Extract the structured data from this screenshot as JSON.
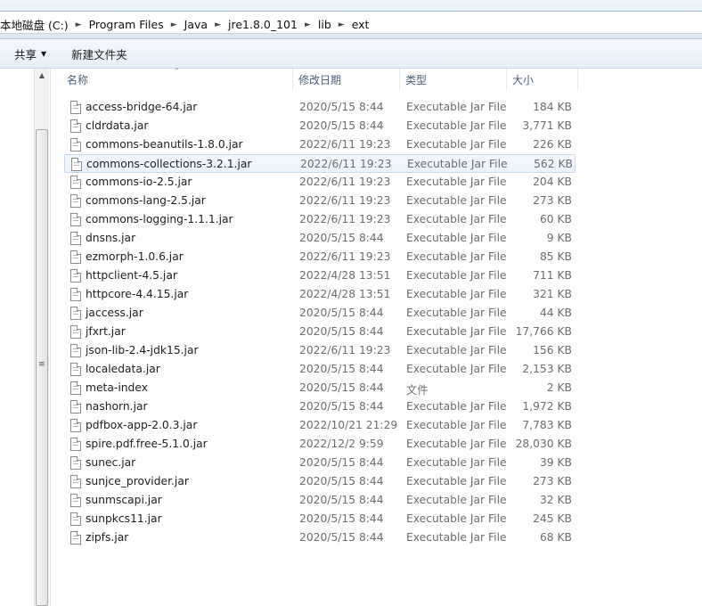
{
  "breadcrumbs": [
    "本地磁盘 (C:)",
    "Program Files",
    "Java",
    "jre1.8.0_101",
    "lib",
    "ext"
  ],
  "toolbar": {
    "share_label": "共享",
    "new_folder_label": "新建文件夹"
  },
  "columns": {
    "name": "名称",
    "date": "修改日期",
    "type": "类型",
    "size": "大小"
  },
  "sort": {
    "column": "name",
    "direction": "ascending"
  },
  "selected_index": 3,
  "files": [
    {
      "name": "access-bridge-64.jar",
      "date": "2020/5/15 8:44",
      "type": "Executable Jar File",
      "size": "184 KB"
    },
    {
      "name": "cldrdata.jar",
      "date": "2020/5/15 8:44",
      "type": "Executable Jar File",
      "size": "3,771 KB"
    },
    {
      "name": "commons-beanutils-1.8.0.jar",
      "date": "2022/6/11 19:23",
      "type": "Executable Jar File",
      "size": "226 KB"
    },
    {
      "name": "commons-collections-3.2.1.jar",
      "date": "2022/6/11 19:23",
      "type": "Executable Jar File",
      "size": "562 KB"
    },
    {
      "name": "commons-io-2.5.jar",
      "date": "2022/6/11 19:23",
      "type": "Executable Jar File",
      "size": "204 KB"
    },
    {
      "name": "commons-lang-2.5.jar",
      "date": "2022/6/11 19:23",
      "type": "Executable Jar File",
      "size": "273 KB"
    },
    {
      "name": "commons-logging-1.1.1.jar",
      "date": "2022/6/11 19:23",
      "type": "Executable Jar File",
      "size": "60 KB"
    },
    {
      "name": "dnsns.jar",
      "date": "2020/5/15 8:44",
      "type": "Executable Jar File",
      "size": "9 KB"
    },
    {
      "name": "ezmorph-1.0.6.jar",
      "date": "2022/6/11 19:23",
      "type": "Executable Jar File",
      "size": "85 KB"
    },
    {
      "name": "httpclient-4.5.jar",
      "date": "2022/4/28 13:51",
      "type": "Executable Jar File",
      "size": "711 KB"
    },
    {
      "name": "httpcore-4.4.15.jar",
      "date": "2022/4/28 13:51",
      "type": "Executable Jar File",
      "size": "321 KB"
    },
    {
      "name": "jaccess.jar",
      "date": "2020/5/15 8:44",
      "type": "Executable Jar File",
      "size": "44 KB"
    },
    {
      "name": "jfxrt.jar",
      "date": "2020/5/15 8:44",
      "type": "Executable Jar File",
      "size": "17,766 KB"
    },
    {
      "name": "json-lib-2.4-jdk15.jar",
      "date": "2022/6/11 19:23",
      "type": "Executable Jar File",
      "size": "156 KB"
    },
    {
      "name": "localedata.jar",
      "date": "2020/5/15 8:44",
      "type": "Executable Jar File",
      "size": "2,153 KB"
    },
    {
      "name": "meta-index",
      "date": "2020/5/15 8:44",
      "type": "文件",
      "size": "2 KB"
    },
    {
      "name": "nashorn.jar",
      "date": "2020/5/15 8:44",
      "type": "Executable Jar File",
      "size": "1,972 KB"
    },
    {
      "name": "pdfbox-app-2.0.3.jar",
      "date": "2022/10/21 21:29",
      "type": "Executable Jar File",
      "size": "7,783 KB"
    },
    {
      "name": "spire.pdf.free-5.1.0.jar",
      "date": "2022/12/2 9:59",
      "type": "Executable Jar File",
      "size": "28,030 KB"
    },
    {
      "name": "sunec.jar",
      "date": "2020/5/15 8:44",
      "type": "Executable Jar File",
      "size": "39 KB"
    },
    {
      "name": "sunjce_provider.jar",
      "date": "2020/5/15 8:44",
      "type": "Executable Jar File",
      "size": "273 KB"
    },
    {
      "name": "sunmscapi.jar",
      "date": "2020/5/15 8:44",
      "type": "Executable Jar File",
      "size": "32 KB"
    },
    {
      "name": "sunpkcs11.jar",
      "date": "2020/5/15 8:44",
      "type": "Executable Jar File",
      "size": "245 KB"
    },
    {
      "name": "zipfs.jar",
      "date": "2020/5/15 8:44",
      "type": "Executable Jar File",
      "size": "68 KB"
    }
  ],
  "icons": {
    "file": "file-icon",
    "separator": "chevron-right-icon",
    "dropdown": "dropdown-arrow-icon",
    "sort": "sort-arrow-icon",
    "scroll_up": "scroll-up-arrow-icon",
    "grip": "scrollbar-grip-icon"
  },
  "colors": {
    "header_text": "#4c607a",
    "detail_text": "#6d6d6d",
    "selection_border": "#c7dbf0",
    "toolbar_bg": "#e5eef8"
  }
}
